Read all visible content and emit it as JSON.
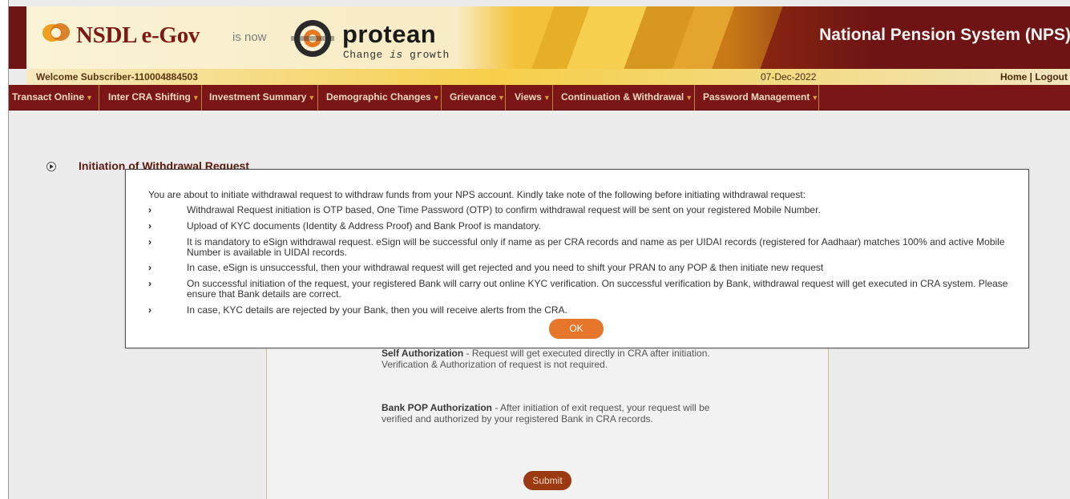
{
  "header": {
    "brand_left": "NSDL e-Gov",
    "is_now": "is now",
    "brand_right": "protean",
    "tagline_pre": "Change ",
    "tagline_em": "is",
    "tagline_post": " growth",
    "system_title": "National Pension System (NPS)",
    "colors": {
      "maroon": "#6e1414",
      "gold": "#f4c23a"
    }
  },
  "welcome": {
    "text": "Welcome Subscriber-110004884503",
    "date": "07-Dec-2022",
    "links": "Home | Logout"
  },
  "menu": {
    "items": [
      {
        "label": "Transact Online"
      },
      {
        "label": "Inter CRA Shifting"
      },
      {
        "label": "Investment Summary"
      },
      {
        "label": "Demographic Changes"
      },
      {
        "label": "Grievance"
      },
      {
        "label": "Views"
      },
      {
        "label": "Continuation & Withdrawal"
      },
      {
        "label": "Password Management"
      }
    ]
  },
  "page": {
    "section_title": "Initiation of Withdrawal Request",
    "self_auth": {
      "title": "Self Authorization",
      "text": " - Request will get executed directly in CRA after initiation. Verification & Authorization of request is not required."
    },
    "bank_auth": {
      "title": "Bank POP Authorization",
      "text": " - After initiation of exit request, your request will be verified and authorized by your registered Bank in CRA records."
    },
    "submit_label": "Submit"
  },
  "modal": {
    "intro": "You are about to initiate withdrawal request to withdraw funds from your NPS account. Kindly take note of the following before initiating withdrawal request:",
    "bullet_glyph": "›",
    "bullets": [
      "Withdrawal Request initiation is OTP based, One Time Password (OTP) to confirm withdrawal request will be sent on your registered Mobile Number.",
      "Upload of KYC documents (Identity & Address Proof) and Bank Proof is mandatory.",
      "It is mandatory to eSign withdrawal request. eSign will be successful only if name as per CRA records and name as per UIDAI records (registered for Aadhaar) matches 100% and active Mobile Number is available in UIDAI records.",
      "In case, eSign is unsuccessful, then your withdrawal request will get rejected and you need to shift your PRAN to any POP & then initiate new request",
      "On successful initiation of the request, your registered Bank will carry out online KYC verification. On successful verification by Bank, withdrawal request will get executed in CRA system. Please ensure that Bank details are correct.",
      "In case, KYC details are rejected by your Bank, then you will receive alerts from the CRA."
    ],
    "ok_label": "OK"
  }
}
